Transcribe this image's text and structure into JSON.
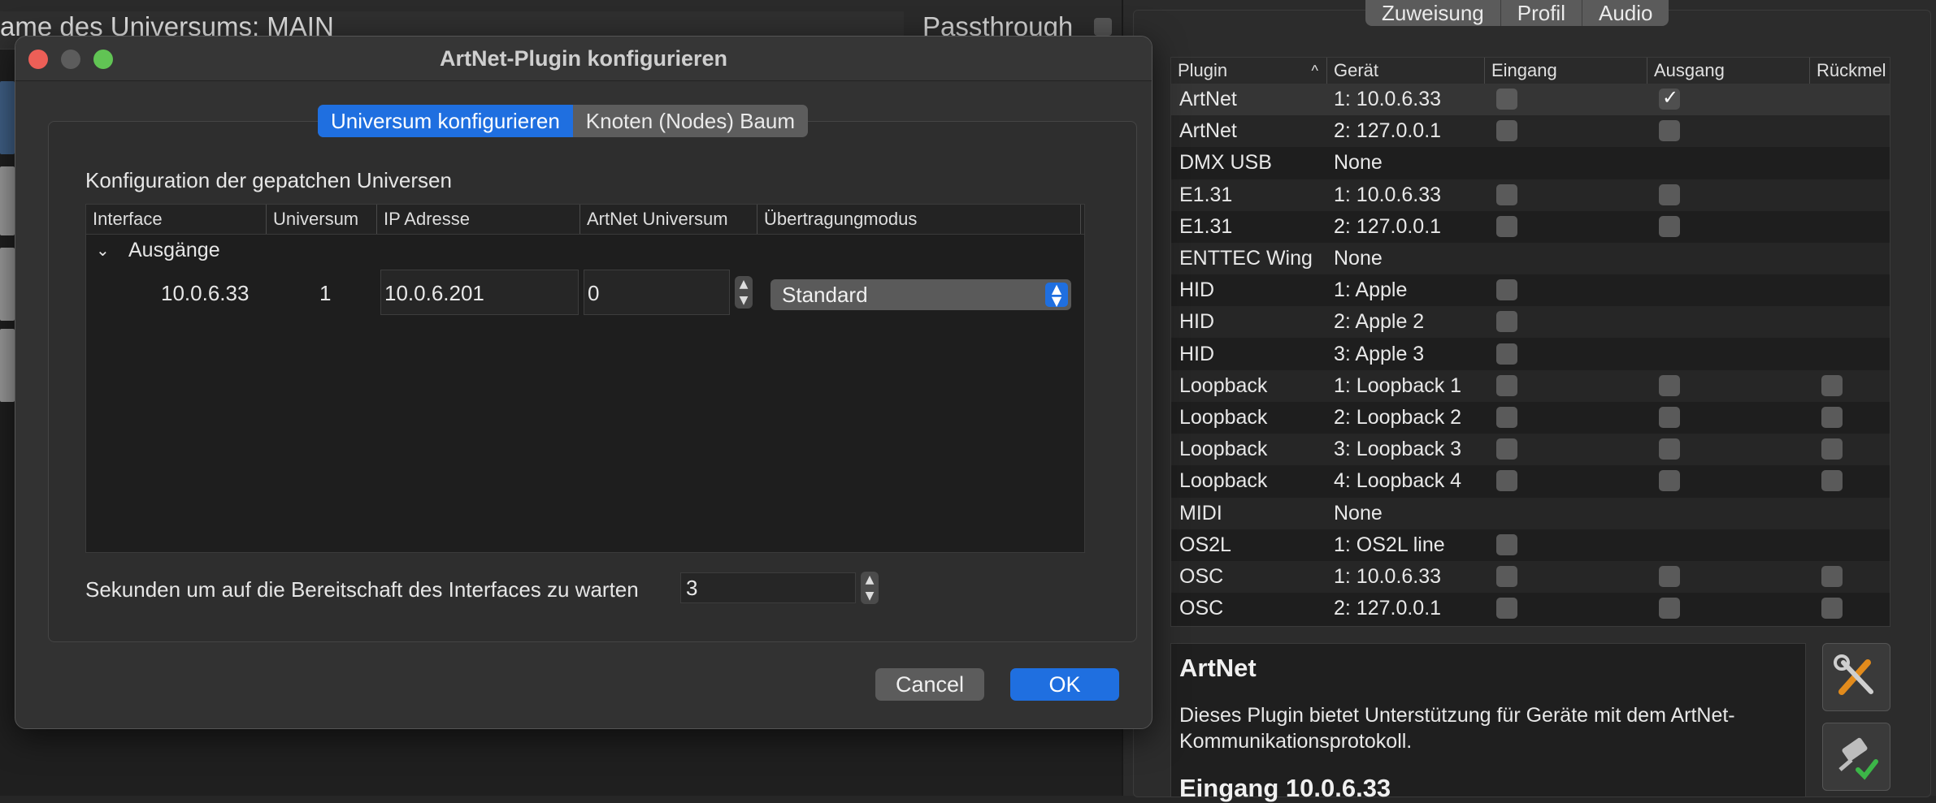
{
  "background": {
    "universe_name_label": "ame des Universums: MAIN",
    "passthrough_label": "Passthrough"
  },
  "right_panel": {
    "tabs": [
      "Zuweisung",
      "Profil",
      "Audio"
    ],
    "table": {
      "columns": [
        "Plugin",
        "Gerät",
        "Eingang",
        "Ausgang",
        "Rückmel"
      ],
      "sort_indicator": "^",
      "rows": [
        {
          "plugin": "ArtNet",
          "device": "1: 10.0.6.33",
          "input": false,
          "output": true,
          "feedback": null
        },
        {
          "plugin": "ArtNet",
          "device": "2: 127.0.0.1",
          "input": false,
          "output": false,
          "feedback": null
        },
        {
          "plugin": "DMX USB",
          "device": "None",
          "input": null,
          "output": null,
          "feedback": null
        },
        {
          "plugin": "E1.31",
          "device": "1: 10.0.6.33",
          "input": false,
          "output": false,
          "feedback": null
        },
        {
          "plugin": "E1.31",
          "device": "2: 127.0.0.1",
          "input": false,
          "output": false,
          "feedback": null
        },
        {
          "plugin": "ENTTEC Wing",
          "device": "None",
          "input": null,
          "output": null,
          "feedback": null
        },
        {
          "plugin": "HID",
          "device": "1: Apple",
          "input": false,
          "output": null,
          "feedback": null
        },
        {
          "plugin": "HID",
          "device": "2: Apple  2",
          "input": false,
          "output": null,
          "feedback": null
        },
        {
          "plugin": "HID",
          "device": "3: Apple  3",
          "input": false,
          "output": null,
          "feedback": null
        },
        {
          "plugin": "Loopback",
          "device": "1: Loopback 1",
          "input": false,
          "output": false,
          "feedback": false
        },
        {
          "plugin": "Loopback",
          "device": "2: Loopback 2",
          "input": false,
          "output": false,
          "feedback": false
        },
        {
          "plugin": "Loopback",
          "device": "3: Loopback 3",
          "input": false,
          "output": false,
          "feedback": false
        },
        {
          "plugin": "Loopback",
          "device": "4: Loopback 4",
          "input": false,
          "output": false,
          "feedback": false
        },
        {
          "plugin": "MIDI",
          "device": "None",
          "input": null,
          "output": null,
          "feedback": null
        },
        {
          "plugin": "OS2L",
          "device": "1: OS2L line",
          "input": false,
          "output": null,
          "feedback": null
        },
        {
          "plugin": "OSC",
          "device": "1: 10.0.6.33",
          "input": false,
          "output": false,
          "feedback": false
        },
        {
          "plugin": "OSC",
          "device": "2: 127.0.0.1",
          "input": false,
          "output": false,
          "feedback": false
        }
      ]
    },
    "description": {
      "title": "ArtNet",
      "text": "Dieses Plugin bietet Unterstützung für Geräte mit dem ArtNet-Kommunikationsprotokoll.",
      "subheading": "Eingang 10.0.6.33"
    },
    "tool_icons": [
      "tools-icon",
      "plug-check-icon"
    ]
  },
  "dialog": {
    "title": "ArtNet-Plugin konfigurieren",
    "tabs": [
      {
        "label": "Universum konfigurieren",
        "active": true
      },
      {
        "label": "Knoten (Nodes) Baum",
        "active": false
      }
    ],
    "section_label": "Konfiguration der gepatchen Universen",
    "table": {
      "columns": [
        "Interface",
        "Universum",
        "IP Adresse",
        "ArtNet Universum",
        "Übertragungmodus"
      ],
      "group_label": "Ausgänge",
      "row": {
        "interface": "10.0.6.33",
        "universe": "1",
        "ip_address": "10.0.6.201",
        "artnet_universe": "0",
        "mode": "Standard"
      }
    },
    "wait_label": "Sekunden um auf die Bereitschaft des Interfaces zu warten",
    "wait_value": "3",
    "cancel_label": "Cancel",
    "ok_label": "OK"
  },
  "colors": {
    "accent": "#1f6fe0",
    "close": "#ec5f57",
    "minimize": "#5c5c5c",
    "zoom": "#61c454"
  }
}
